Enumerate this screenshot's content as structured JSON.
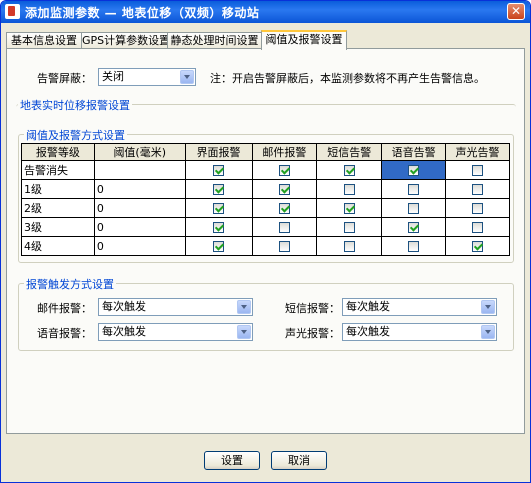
{
  "window": {
    "title": "添加监测参数 — 地表位移（双频）移动站",
    "close_glyph": "✕"
  },
  "tabs": [
    {
      "label": "基本信息设置"
    },
    {
      "label": "GPS计算参数设置"
    },
    {
      "label": "静态处理时间设置"
    },
    {
      "label": "阈值及报警设置"
    }
  ],
  "alarm_mask": {
    "label": "告警屏蔽：",
    "value": "关闭",
    "note": "注：开启告警屏蔽后，本监测参数将不再产生告警信息。"
  },
  "section_realtime": "地表实时位移报警设置",
  "section_threshold": "阈值及报警方式设置",
  "table": {
    "headers": [
      "报警等级",
      "阈值(毫米)",
      "界面报警",
      "邮件报警",
      "短信告警",
      "语音告警",
      "声光告警"
    ],
    "rows": [
      {
        "level": "告警消失",
        "threshold": "",
        "checks": [
          true,
          true,
          true,
          true,
          false
        ]
      },
      {
        "level": "1级",
        "threshold": "0",
        "checks": [
          true,
          true,
          false,
          false,
          false
        ]
      },
      {
        "level": "2级",
        "threshold": "0",
        "checks": [
          true,
          true,
          true,
          false,
          false
        ]
      },
      {
        "level": "3级",
        "threshold": "0",
        "checks": [
          true,
          false,
          false,
          true,
          false
        ]
      },
      {
        "level": "4级",
        "threshold": "0",
        "checks": [
          true,
          false,
          false,
          false,
          true
        ]
      }
    ]
  },
  "section_trigger": "报警触发方式设置",
  "trigger": {
    "mail_label": "邮件报警：",
    "mail_value": "每次触发",
    "sms_label": "短信报警：",
    "sms_value": "每次触发",
    "voice_label": "语音报警：",
    "voice_value": "每次触发",
    "light_label": "声光报警：",
    "light_value": "每次触发"
  },
  "buttons": {
    "ok": "设置",
    "cancel": "取消"
  },
  "colors": {
    "title_blue": "#0a5ddb",
    "section_blue": "#0046d5",
    "selected_cell": "#316ac5",
    "check_green": "#21a121"
  }
}
